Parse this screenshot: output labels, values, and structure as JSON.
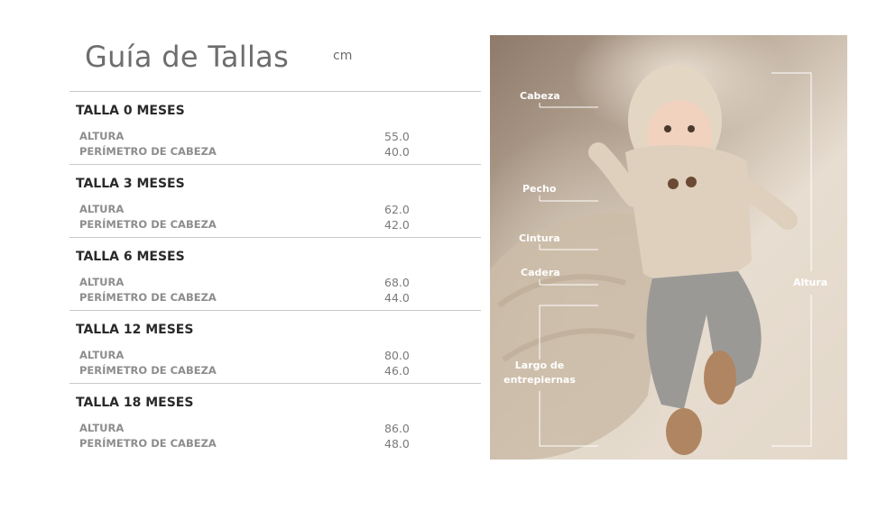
{
  "title": "Guía de Tallas",
  "unit": "cm",
  "sizes": [
    {
      "name": "TALLA 0 MESES",
      "rows": [
        {
          "label": "ALTURA",
          "value": "55.0"
        },
        {
          "label": "PERÍMETRO DE CABEZA",
          "value": "40.0"
        }
      ]
    },
    {
      "name": "TALLA 3 MESES",
      "rows": [
        {
          "label": "ALTURA",
          "value": "62.0"
        },
        {
          "label": "PERÍMETRO DE CABEZA",
          "value": "42.0"
        }
      ]
    },
    {
      "name": "TALLA 6 MESES",
      "rows": [
        {
          "label": "ALTURA",
          "value": "68.0"
        },
        {
          "label": "PERÍMETRO DE CABEZA",
          "value": "44.0"
        }
      ]
    },
    {
      "name": "TALLA 12 MESES",
      "rows": [
        {
          "label": "ALTURA",
          "value": "80.0"
        },
        {
          "label": "PERÍMETRO DE CABEZA",
          "value": "46.0"
        }
      ]
    },
    {
      "name": "TALLA 18 MESES",
      "rows": [
        {
          "label": "ALTURA",
          "value": "86.0"
        },
        {
          "label": "PERÍMETRO DE CABEZA",
          "value": "48.0"
        }
      ]
    }
  ],
  "photo_labels": {
    "cabeza": "Cabeza",
    "pecho": "Pecho",
    "cintura": "Cintura",
    "cadera": "Cadera",
    "largo_line1": "Largo de",
    "largo_line2": "entrepiernas",
    "altura": "Altura"
  }
}
